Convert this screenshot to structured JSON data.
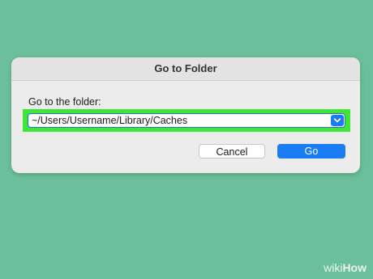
{
  "dialog": {
    "title": "Go to Folder",
    "prompt_label": "Go to the folder:",
    "path_value": "~/Users/Username/Library/Caches",
    "dropdown_icon": "chevron-down-icon",
    "cancel_label": "Cancel",
    "go_label": "Go"
  },
  "watermark": {
    "part1": "wiki",
    "part2": "How"
  },
  "colors": {
    "background": "#6bbf9a",
    "highlight": "#3ee63a",
    "accent": "#1a7cf5"
  }
}
